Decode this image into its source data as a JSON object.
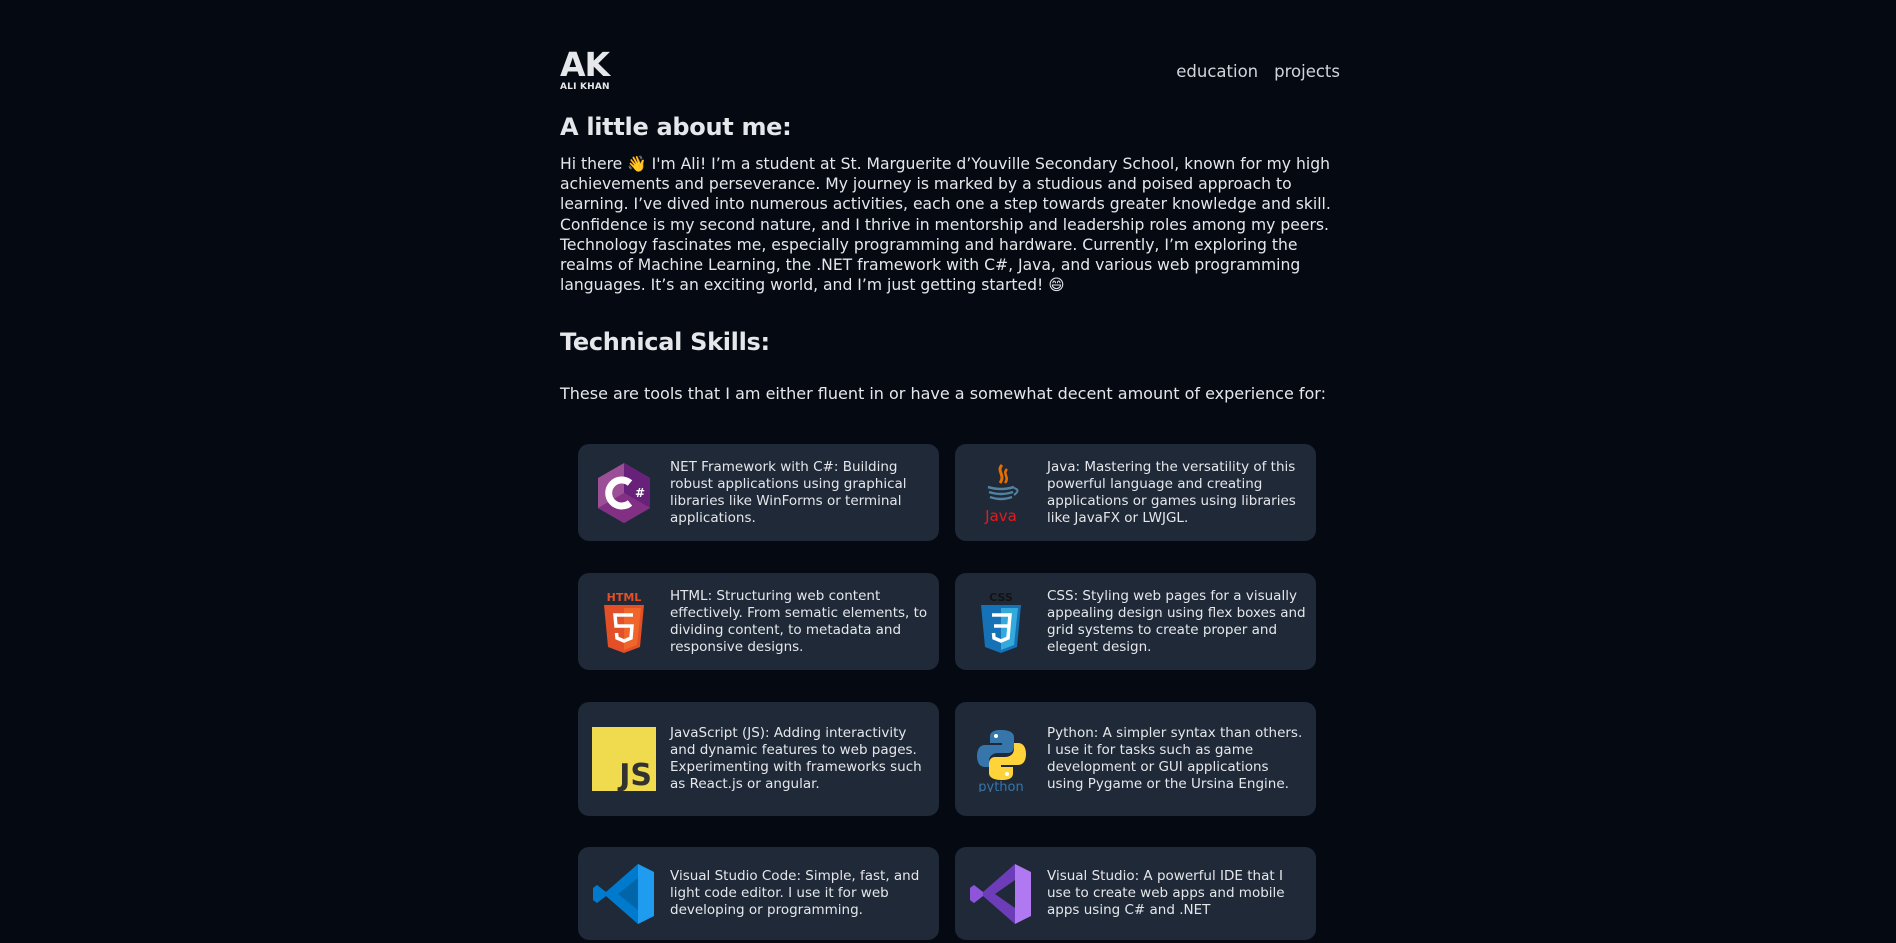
{
  "header": {
    "logo_mark": "AK",
    "logo_name": "ALI KHAN",
    "nav": [
      {
        "label": "education"
      },
      {
        "label": "projects"
      }
    ]
  },
  "about": {
    "title": "A little about me:",
    "text": "Hi there 👋 I'm Ali! I’m a student at St. Marguerite d’Youville Secondary School, known for my high achievements and perseverance. My journey is marked by a studious and poised approach to learning. I’ve dived into numerous activities, each one a step towards greater knowledge and skill. Confidence is my second nature, and I thrive in mentorship and leadership roles among my peers. Technology fascinates me, especially programming and hardware. Currently, I’m exploring the realms of Machine Learning, the .NET framework with C#, Java, and various web programming languages. It’s an exciting world, and I’m just getting started! 😄"
  },
  "skills": {
    "title": "Technical Skills:",
    "intro": "These are tools that I am either fluent in or have a somewhat decent amount of experience for:",
    "items": [
      {
        "icon": "csharp-icon",
        "text": "NET Framework with C#: Building robust applications using graphical libraries like WinForms or terminal applications."
      },
      {
        "icon": "java-icon",
        "text": "Java: Mastering the versatility of this powerful language and creating applications or games using libraries like JavaFX or LWJGL."
      },
      {
        "icon": "html5-icon",
        "text": "HTML: Structuring web content effectively. From sematic elements, to dividing content, to metadata and responsive designs."
      },
      {
        "icon": "css3-icon",
        "text": "CSS: Styling web pages for a visually appealing design using flex boxes and grid systems to create proper and elegent design."
      },
      {
        "icon": "javascript-icon",
        "text": "JavaScript (JS): Adding interactivity and dynamic features to web pages. Experimenting with frameworks such as React.js or angular."
      },
      {
        "icon": "python-icon",
        "text": "Python: A simpler syntax than others. I use it for tasks such as game development or GUI applications using Pygame or the Ursina Engine."
      },
      {
        "icon": "vscode-icon",
        "text": "Visual Studio Code: Simple, fast, and light code editor. I use it for web developing or programming."
      },
      {
        "icon": "visual-studio-icon",
        "text": "Visual Studio: A powerful IDE that I use to create web apps and mobile apps using C# and .NET"
      }
    ],
    "icon_labels": {
      "html": "HTML",
      "css": "CSS",
      "js": "JS",
      "java": "Java",
      "python": "python"
    }
  },
  "colors": {
    "background": "#050a12",
    "card": "#1f2937",
    "text": "#e5e7eb"
  }
}
